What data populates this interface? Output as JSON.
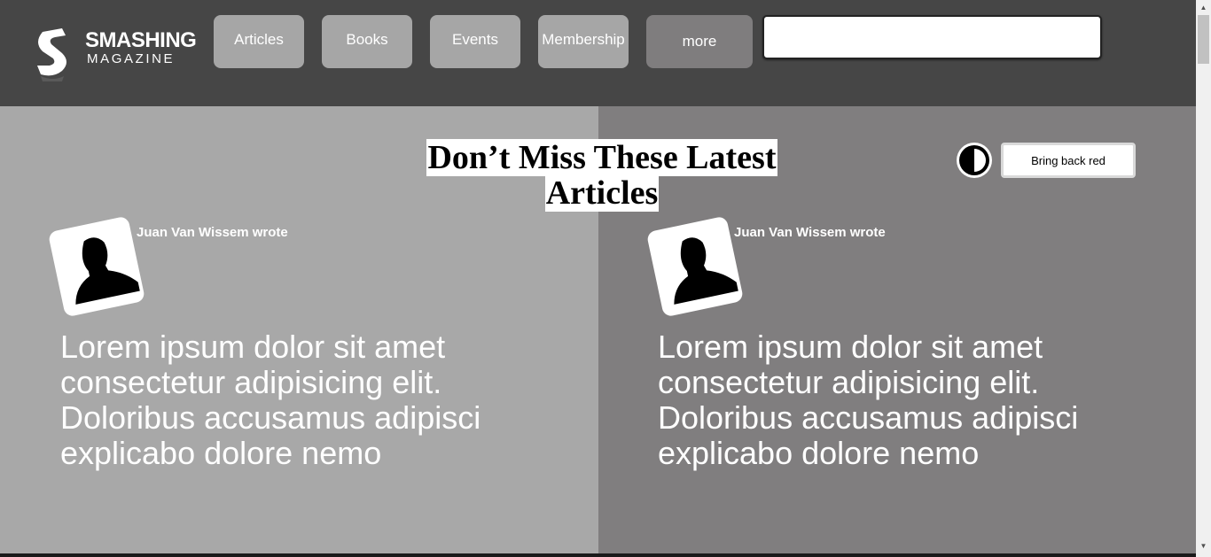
{
  "header": {
    "logo": {
      "line1": "SMASHING",
      "line2": "MAGAZINE"
    },
    "nav": [
      {
        "label": "Articles"
      },
      {
        "label": "Books"
      },
      {
        "label": "Events"
      },
      {
        "label": "Membership"
      },
      {
        "label": "more"
      }
    ],
    "search": {
      "value": "",
      "placeholder": ""
    }
  },
  "main": {
    "heading": "Don’t Miss These Latest Articles",
    "contrast_icon": "contrast-icon",
    "bring_back_red_label": "Bring back red",
    "articles": [
      {
        "author": "Juan Van Wissem wrote",
        "excerpt": "Lorem ipsum dolor sit amet consectetur adipisicing elit. Doloribus accusamus adipisci explicabo dolore nemo",
        "avatar_icon": "person-silhouette-icon"
      },
      {
        "author": "Juan Van Wissem wrote",
        "excerpt": "Lorem ipsum dolor sit amet consectetur adipisicing elit. Doloribus accusamus adipisci explicabo dolore nemo",
        "avatar_icon": "person-silhouette-icon"
      }
    ]
  },
  "colors": {
    "header_bg": "#464646",
    "nav_button": "#a6a6a6",
    "nav_more": "#7f7d7e",
    "left_column": "#a8a8a8",
    "right_column": "#807e7f"
  }
}
